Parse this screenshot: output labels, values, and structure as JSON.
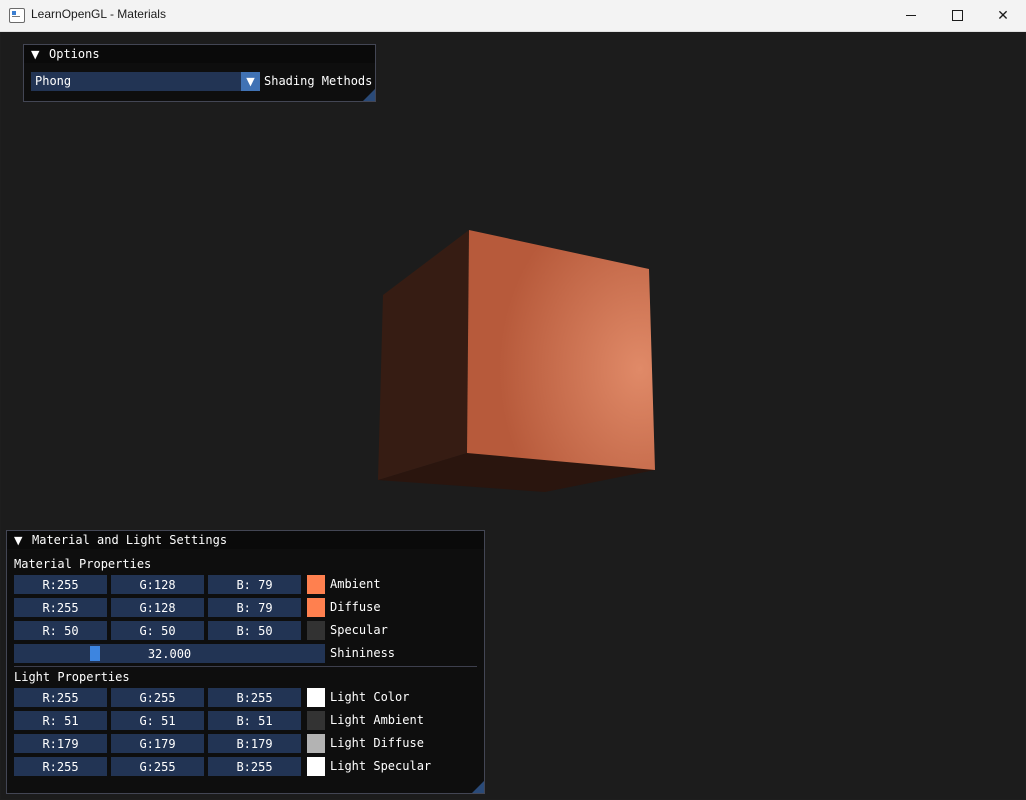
{
  "window": {
    "title": "LearnOpenGL - Materials",
    "minimize_icon": "minimize-icon",
    "maximize_icon": "maximize-icon",
    "close_glyph": "✕"
  },
  "options": {
    "title": "Options",
    "collapse_glyph": "▼",
    "combo_value": "Phong",
    "combo_arrow": "▼",
    "combo_label": "Shading Methods"
  },
  "settings": {
    "title": "Material and Light Settings",
    "collapse_glyph": "▼",
    "material_header": "Material Properties",
    "light_header": "Light Properties",
    "ambient": {
      "r": "R:255",
      "g": "G:128",
      "b": "B: 79",
      "label": "Ambient",
      "color": "#ff804f"
    },
    "diffuse": {
      "r": "R:255",
      "g": "G:128",
      "b": "B: 79",
      "label": "Diffuse",
      "color": "#ff804f"
    },
    "specular": {
      "r": "R: 50",
      "g": "G: 50",
      "b": "B: 50",
      "label": "Specular",
      "color": "#323232"
    },
    "shininess": {
      "value": "32.000",
      "label": "Shininess",
      "fraction": 0.25
    },
    "light_color": {
      "r": "R:255",
      "g": "G:255",
      "b": "B:255",
      "label": "Light Color",
      "color": "#ffffff"
    },
    "light_ambient": {
      "r": "R: 51",
      "g": "G: 51",
      "b": "B: 51",
      "label": "Light Ambient",
      "color": "#333333"
    },
    "light_diffuse": {
      "r": "R:179",
      "g": "G:179",
      "b": "B:179",
      "label": "Light Diffuse",
      "color": "#b3b3b3"
    },
    "light_specular": {
      "r": "R:255",
      "g": "G:255",
      "b": "B:255",
      "label": "Light Specular",
      "color": "#ffffff"
    }
  },
  "colors": {
    "viewport_background": "#1c1c1c",
    "cube_front": "#b75a3b",
    "cube_highlight": "#e08a68",
    "cube_side": "#361c13",
    "cube_bottom": "#2a150e",
    "frame_bg": "#223454",
    "accent": "#3d85e0"
  }
}
